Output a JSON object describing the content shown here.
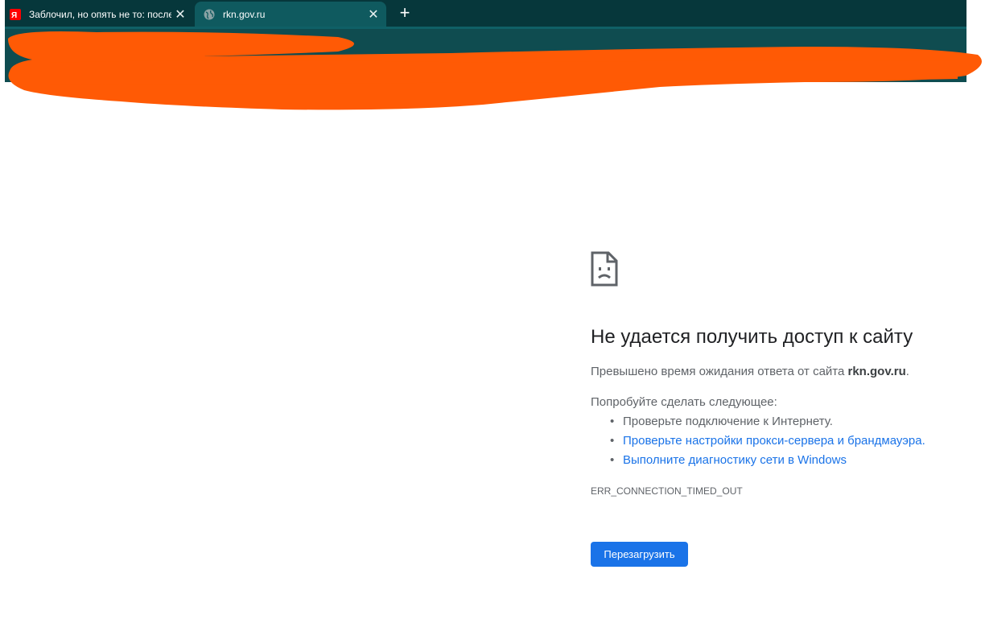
{
  "browser": {
    "tabs": [
      {
        "title": "Заблочил, но опять не то: после"
      },
      {
        "title": "rkn.gov.ru"
      }
    ],
    "close_glyph": "✕",
    "new_tab_glyph": "+",
    "theme_color": "#08373b",
    "redaction_color": "#ff5a05"
  },
  "error": {
    "icon": "sad-document-icon",
    "title": "Не удается получить доступ к сайту",
    "description_prefix": "Превышено время ожидания ответа от сайта ",
    "site": "rkn.gov.ru",
    "description_suffix": ".",
    "try_label": "Попробуйте сделать следующее:",
    "suggestions": [
      "Проверьте подключение к Интернету.",
      "Проверьте настройки прокси-сервера и брандмауэра.",
      "Выполните диагностику сети в Windows"
    ],
    "code": "ERR_CONNECTION_TIMED_OUT",
    "reload_label": "Перезагрузить",
    "link_color": "#1a73e8"
  }
}
